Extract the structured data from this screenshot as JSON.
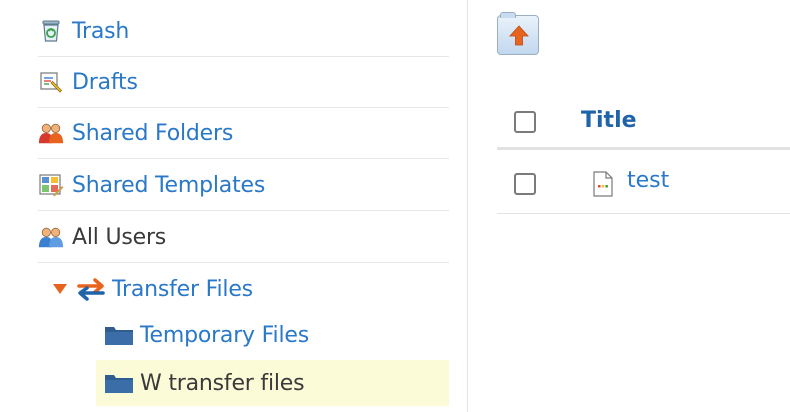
{
  "sidebar": {
    "items": [
      {
        "label": "Trash",
        "icon": "trash-icon"
      },
      {
        "label": "Drafts",
        "icon": "drafts-icon"
      },
      {
        "label": "Shared Folders",
        "icon": "shared-folders-icon"
      },
      {
        "label": "Shared Templates",
        "icon": "shared-templates-icon"
      },
      {
        "label": "All Users",
        "icon": "all-users-icon"
      }
    ],
    "transfer": {
      "label": "Transfer Files",
      "expanded": true,
      "icon": "transfer-icon",
      "children": [
        {
          "label": "Temporary Files",
          "icon": "folder-icon",
          "selected": false
        },
        {
          "label": "W transfer files",
          "icon": "folder-icon",
          "selected": true
        }
      ]
    }
  },
  "main": {
    "toolbar": {
      "up_icon": "folder-up-icon"
    },
    "table": {
      "columns": [
        {
          "label": "Title"
        }
      ],
      "rows": [
        {
          "title": "test",
          "icon": "document-icon",
          "checked": false
        }
      ]
    }
  },
  "colors": {
    "link": "#2a78c8",
    "header": "#1f64a8",
    "accent_orange": "#e8641e",
    "selected_bg": "#fcfbd8",
    "folder": "#2f5d8f"
  }
}
